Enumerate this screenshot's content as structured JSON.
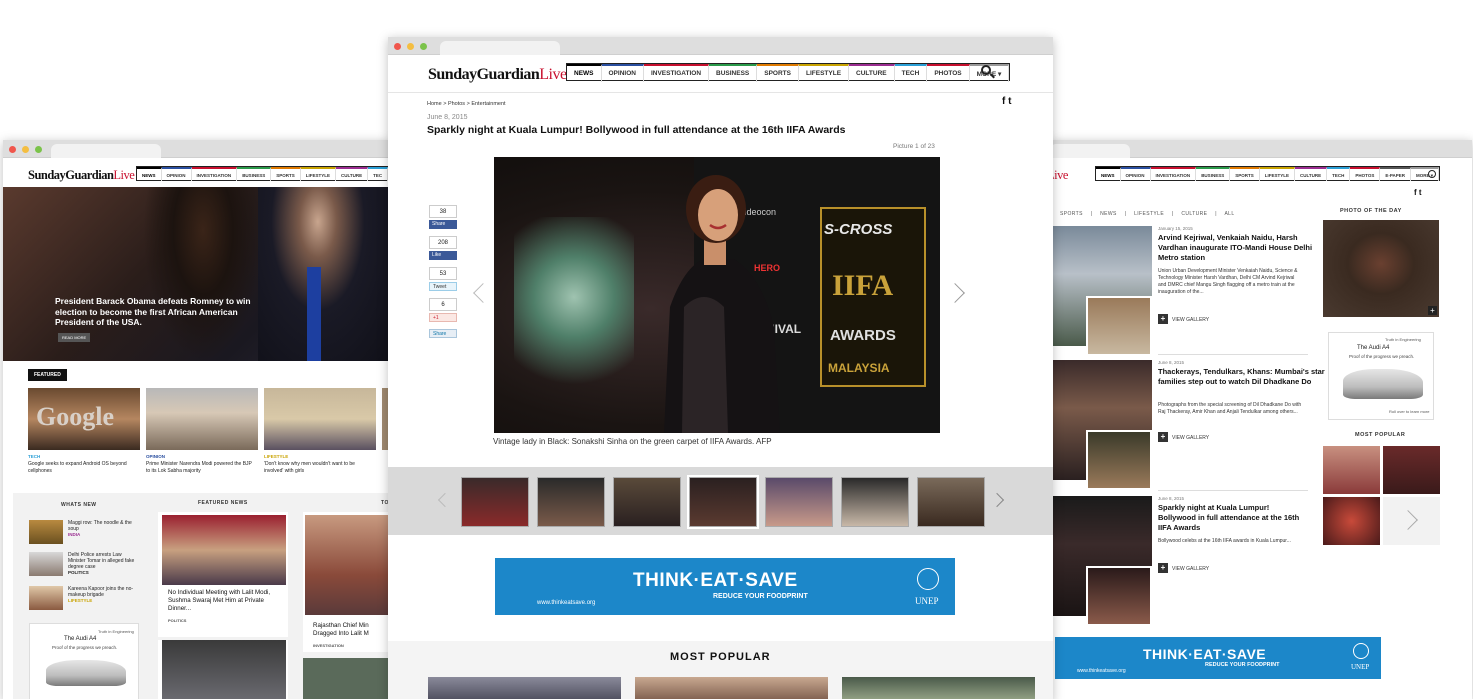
{
  "brand": {
    "logo_main": "SundayGuardian",
    "logo_live": "Live"
  },
  "nav": [
    "NEWS",
    "OPINION",
    "INVESTIGATION",
    "BUSINESS",
    "SPORTS",
    "LIFESTYLE",
    "CULTURE",
    "TECH",
    "PHOTOS",
    "More ▾"
  ],
  "nav_right": [
    "NEWS",
    "OPINION",
    "INVESTIGATION",
    "BUSINESS",
    "SPORTS",
    "LIFESTYLE",
    "CULTURE",
    "TECH",
    "PHOTOS",
    "E-paper",
    "More ▾"
  ],
  "nav_left": [
    "NEWS",
    "OPINION",
    "INVESTIGATION",
    "BUSINESS",
    "SPORTS",
    "LIFESTYLE",
    "CULTURE",
    "TEC"
  ],
  "center": {
    "breadcrumb": "Home  >  Photos  >  Entertainment",
    "social": "f  t",
    "date": "June 8, 2015",
    "title": "Sparkly night at Kuala Lumpur! Bollywood in full attendance at the 16th IIFA Awards",
    "picture_count": "Picture 1 of 23",
    "share": {
      "fb_count": "38",
      "fb_label": "Share",
      "like_count": "208",
      "like_label": "Like",
      "tweet_count": "53",
      "tweet_label": "Tweet",
      "gplus_count": "6",
      "gplus_label": "+1",
      "in_label": "Share"
    },
    "photo_text": {
      "iifa": "IIFA",
      "awards": "AWARDS",
      "malaysia": "MALAYSIA",
      "scross": "S-CROSS",
      "carnival": "CARNIVAL",
      "videocon": "videocon",
      "hero": "HERO"
    },
    "caption": "Vintage lady in Black: Sonakshi Sinha on the green carpet of IIFA Awards. AFP",
    "most_popular": "MOST POPULAR"
  },
  "banner": {
    "headline": "THINK·EAT·SAVE",
    "sub": "REDUCE YOUR FOODPRINT",
    "url": "www.thinkeatsave.org",
    "org": "UNEP"
  },
  "left": {
    "hero_headline": "President Barack Obama defeats Romney to win election to become the first African American President of the USA.",
    "read_more": "READ MORE",
    "featured_label": "FEATURED",
    "featured": [
      {
        "cat": "TECH",
        "text": "Google seeks to expand Android OS beyond cellphones",
        "color": "#2a9fd6"
      },
      {
        "cat": "OPINION",
        "text": "Prime Minister Narendra Modi powered the BJP to its Lok Sabha majority",
        "color": "#2a4fa0"
      },
      {
        "cat": "LIFESTYLE",
        "text": "'Don't know why men wouldn't want to be involved' with girls",
        "color": "#c9a300"
      }
    ],
    "whats_new_head": "WHATS NEW",
    "featured_news_head": "FEATURED NEWS",
    "top_head": "TO",
    "whats_new": [
      {
        "text": "Maggi row: The noodle & the soup",
        "cat": "INDIA",
        "color": "#9b2d91"
      },
      {
        "text": "Delhi Police arrests Law Minister Tomar in alleged fake degree case",
        "cat": "POLITICS",
        "color": "#222"
      },
      {
        "text": "Kareena Kapoor joins the no-makeup brigade",
        "cat": "LIFESTYLE",
        "color": "#c9a300"
      }
    ],
    "featured_news_text": "No Individual Meeting with Lalit Modi, Sushma Swaraj Met Him at Private Dinner...",
    "featured_news_cat": "POLITICS",
    "top_text": "Rajasthan Chief Min Dragged Into Lalit M",
    "top_cat": "INVESTIGATION",
    "ad": {
      "tagline": "Truth in Engineering",
      "model": "The Audi A4",
      "slogan": "Proof of the progress we preach."
    }
  },
  "right": {
    "tabs": [
      "SPORTS",
      "|",
      "NEWS",
      "|",
      "LIFESTYLE",
      "|",
      "CULTURE",
      "|",
      "ALL"
    ],
    "stories": [
      {
        "date": "January 15, 2015",
        "head": "Arvind Kejriwal, Venkaiah Naidu, Harsh Vardhan inaugurate ITO-Mandi House Delhi Metro station",
        "body": "Union Urban Development Minister Venkaiah Naidu, Science & Technology Minister Harsh Vardhan, Delhi CM Arvind Kejriwal and DMRC chief Mangu Singh flagging off a metro train at the inauguration of the..."
      },
      {
        "date": "June 8, 2015",
        "head": "Thackerays, Tendulkars, Khans: Mumbai's star families step out to watch Dil Dhadkane Do",
        "body": "Photographs from the special screening of Dil Dhadkane Do with Raj Thackeray, Amir Khan and Anjali Tendulkar among others..."
      },
      {
        "date": "June 8, 2015",
        "head": "Sparkly night at Kuala Lumpur! Bollywood in full attendance at the 16th IIFA Awards",
        "body": "Bollywood celebs at the 16th IIFA awards in Kuala Lumpur..."
      }
    ],
    "view_gallery": "VIEW GALLERY",
    "photo_of_day": "PHOTO OF THE DAY",
    "most_popular": "MOST POPULAR",
    "ad": {
      "tagline": "Truth in Engineering",
      "model": "The Audi A4",
      "slogan": "Proof of the progress we preach.",
      "cta": "Roll over to learn more"
    }
  }
}
